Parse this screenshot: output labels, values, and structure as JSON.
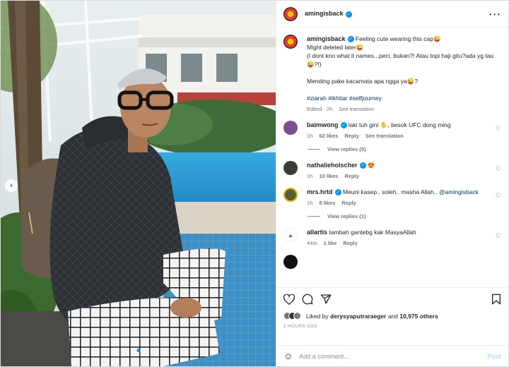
{
  "post": {
    "username": "amingisback",
    "more_icon": "more-horizontal-icon"
  },
  "caption": {
    "username": "amingisback",
    "lines": [
      "Feeling cute wearing this cap😜",
      "Might deleted later😜",
      "(I dont kno what it names...peci, bukan?! Atau topi haji gitu?ada yg tau😜?!)",
      "Mending pake kacamata apa ngga ya😜?"
    ],
    "hashtags": "#ziarah #ikhtiar #selfjourney",
    "edited": "Edited · 2h",
    "see_translation": "See translation"
  },
  "comments": [
    {
      "username": "baimwong",
      "verified": true,
      "text": "laki tuh gini ✋, besok UFC dong ming",
      "time": "1h",
      "likes": "62 likes",
      "reply": "Reply",
      "translation": "See translation",
      "view_replies": "View replies (5)"
    },
    {
      "username": "nathalieholscher",
      "verified": true,
      "text": "😍",
      "time": "1h",
      "likes": "10 likes",
      "reply": "Reply",
      "translation": "",
      "view_replies": ""
    },
    {
      "username": "mrs.hrtd",
      "verified": true,
      "text": "Meuni kasep.. soleh.. masha Allah..",
      "mention": "@amingisback",
      "time": "1h",
      "likes": "8 likes",
      "reply": "Reply",
      "translation": "",
      "view_replies": "View replies (1)"
    },
    {
      "username": "allartis",
      "verified": false,
      "text": "tambah gantebg kak MasyaAllah",
      "time": "44m",
      "likes": "1 like",
      "reply": "Reply",
      "translation": "",
      "view_replies": ""
    }
  ],
  "actions": {
    "liked_by_prefix": "Liked by",
    "liked_by_user": "derysyaputraraeger",
    "liked_by_and": "and",
    "liked_by_count": "10,975 others",
    "timestamp": "2 HOURS AGO"
  },
  "add_comment": {
    "placeholder": "Add a comment...",
    "post_label": "Post"
  },
  "colors": {
    "accent": "#0095f6",
    "link": "#00376b",
    "muted": "#737373",
    "pool": "#2a9ad6"
  }
}
